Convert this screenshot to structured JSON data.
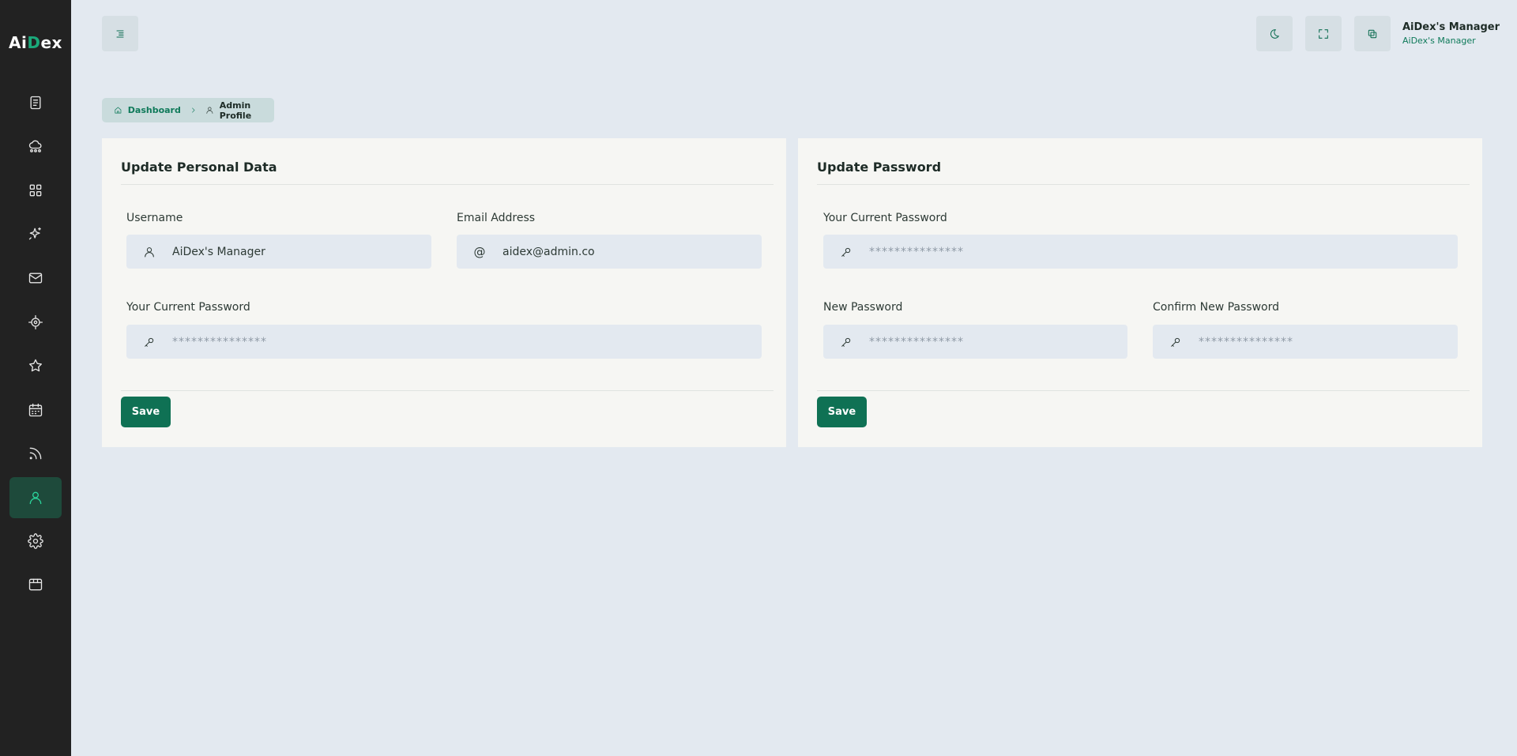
{
  "app": {
    "logo_prefix": "Ai",
    "logo_accent": "D",
    "logo_suffix": "ex",
    "accent_color": "#0f7154"
  },
  "sidebar": {
    "items": [
      {
        "icon": "document-icon"
      },
      {
        "icon": "cloud-network-icon"
      },
      {
        "icon": "grid-icon"
      },
      {
        "icon": "sparkle-icon"
      },
      {
        "icon": "mail-icon"
      },
      {
        "icon": "target-icon"
      },
      {
        "icon": "star-icon"
      },
      {
        "icon": "calendar-icon"
      },
      {
        "icon": "rss-icon"
      },
      {
        "icon": "user-icon",
        "active": true
      },
      {
        "icon": "gear-icon"
      },
      {
        "icon": "box-icon"
      }
    ]
  },
  "header": {
    "user_name": "AiDex's Manager",
    "user_role": "AiDex's Manager"
  },
  "breadcrumb": {
    "home": "Dashboard",
    "current": "Admin Profile"
  },
  "personal": {
    "title": "Update Personal Data",
    "username_label": "Username",
    "username_value": "AiDex's Manager",
    "email_label": "Email Address",
    "email_value": "aidex@admin.co",
    "email_icon": "@",
    "password_label": "Your Current Password",
    "password_placeholder": "***************",
    "save_label": "Save"
  },
  "password": {
    "title": "Update Password",
    "current_label": "Your Current Password",
    "current_placeholder": "***************",
    "new_label": "New Password",
    "new_placeholder": "***************",
    "confirm_label": "Confirm New Password",
    "confirm_placeholder": "***************",
    "save_label": "Save"
  }
}
